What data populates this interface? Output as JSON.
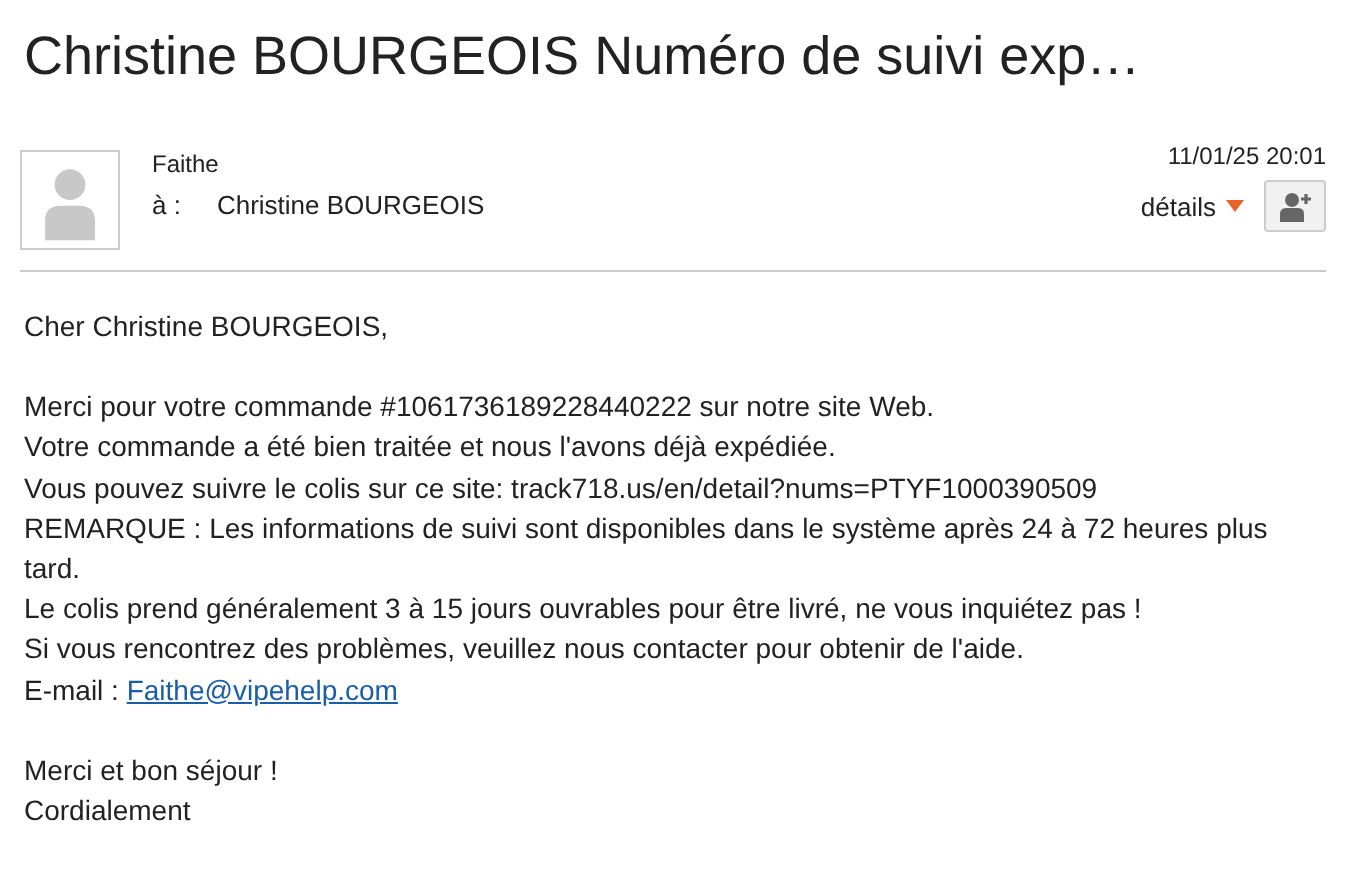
{
  "subject": "Christine BOURGEOIS Numéro de suivi exp…",
  "header": {
    "sender": "Faithe",
    "to_label": "à :",
    "recipient": "Christine BOURGEOIS",
    "date": "11/01/25 20:01",
    "details": "détails"
  },
  "body": [
    {
      "lines": [
        {
          "kind": "text",
          "text": "Cher Christine BOURGEOIS,"
        }
      ]
    },
    {
      "lines": [
        {
          "kind": "text",
          "text": "Merci pour votre commande #1061736189228440222 sur notre site Web."
        },
        {
          "kind": "text",
          "text": "Votre commande a été bien traitée et nous l'avons déjà expédiée."
        },
        {
          "kind": "text",
          "text": "Vous pouvez suivre le colis sur ce site: track718.us/en/detail?nums=PTYF1000390509"
        },
        {
          "kind": "text",
          "text": "REMARQUE : Les informations de suivi sont disponibles dans le système après 24 à 72 heures plus tard."
        },
        {
          "kind": "text",
          "text": "Le colis prend généralement 3 à 15 jours ouvrables pour être livré, ne vous inquiétez pas !"
        },
        {
          "kind": "text",
          "text": "Si vous rencontrez des problèmes, veuillez nous contacter pour obtenir de l'aide."
        },
        {
          "kind": "email",
          "text": "E-mail :",
          "link": "Faithe@vipehelp.com"
        }
      ]
    },
    {
      "lines": [
        {
          "kind": "text",
          "text": "Merci et bon séjour !"
        },
        {
          "kind": "text",
          "text": "Cordialement"
        }
      ]
    }
  ]
}
